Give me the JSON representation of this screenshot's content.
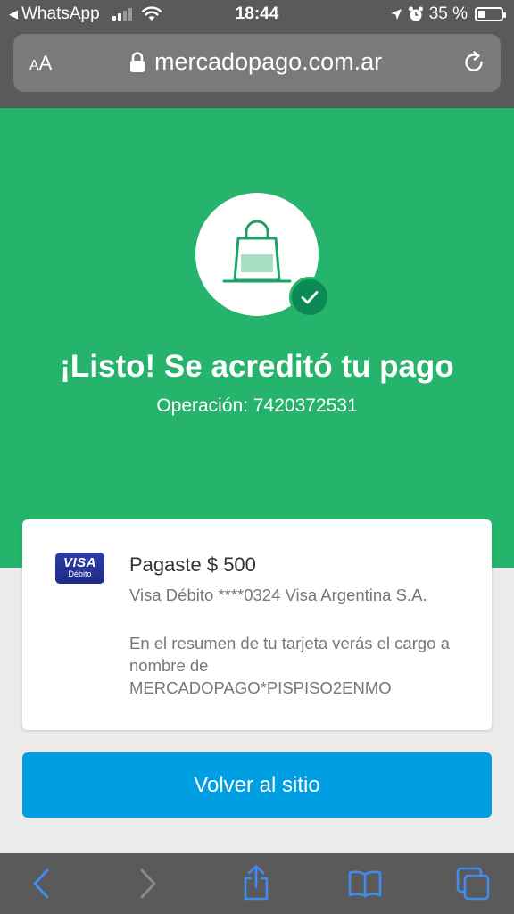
{
  "status_bar": {
    "back_app": "WhatsApp",
    "time": "18:44",
    "battery": "35 %",
    "battery_level": 0.35
  },
  "browser": {
    "aa_label_small": "A",
    "aa_label_large": "A",
    "url": "mercadopago.com.ar"
  },
  "hero": {
    "title": "¡Listo! Se acreditó tu pago",
    "operation": "Operación: 7420372531"
  },
  "payment_card": {
    "card_brand": "VISA",
    "card_type": "Débito",
    "paid": "Pagaste $ 500",
    "card_detail": "Visa Débito ****0324 Visa Argentina S.A.",
    "statement_note": "En el resumen de tu tarjeta verás el cargo a nombre de MERCADOPAGO*PISPISO2ENMO"
  },
  "actions": {
    "back_to_site": "Volver al sitio"
  },
  "colors": {
    "hero_green": "#26b36b",
    "badge_green": "#0b8a56",
    "button_blue": "#009ee3",
    "toolbar_icon_blue": "#3f8cf0"
  },
  "icons": {
    "hero": "shopping-bag-icon",
    "badge": "check-icon",
    "toolbar": [
      "back-arrow-icon",
      "forward-arrow-icon",
      "share-icon",
      "bookmarks-icon",
      "tabs-icon"
    ]
  }
}
